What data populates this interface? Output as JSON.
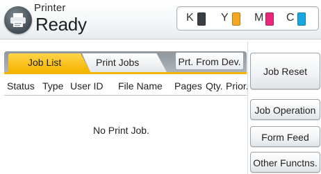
{
  "header": {
    "mode_label": "Printer",
    "status": "Ready",
    "toners": [
      {
        "letter": "K",
        "color": "#3a3f44"
      },
      {
        "letter": "Y",
        "color": "#f5a623"
      },
      {
        "letter": "M",
        "color": "#e8287a"
      },
      {
        "letter": "C",
        "color": "#1aa7e0"
      }
    ]
  },
  "tabs": {
    "job_list": "Job List",
    "print_jobs": "Print Jobs",
    "active_color": "#f5b400"
  },
  "print_from_device_label": "Prt. From Dev.",
  "columns": {
    "status": "Status",
    "type": "Type",
    "user_id": "User ID",
    "file_name": "File Name",
    "pages": "Pages",
    "qty": "Qty.",
    "prior": "Prior."
  },
  "empty_message": "No Print Job.",
  "side_buttons": {
    "job_reset": "Job Reset",
    "job_operation": "Job Operation",
    "form_feed": "Form Feed",
    "other_functions": "Other Functns."
  }
}
